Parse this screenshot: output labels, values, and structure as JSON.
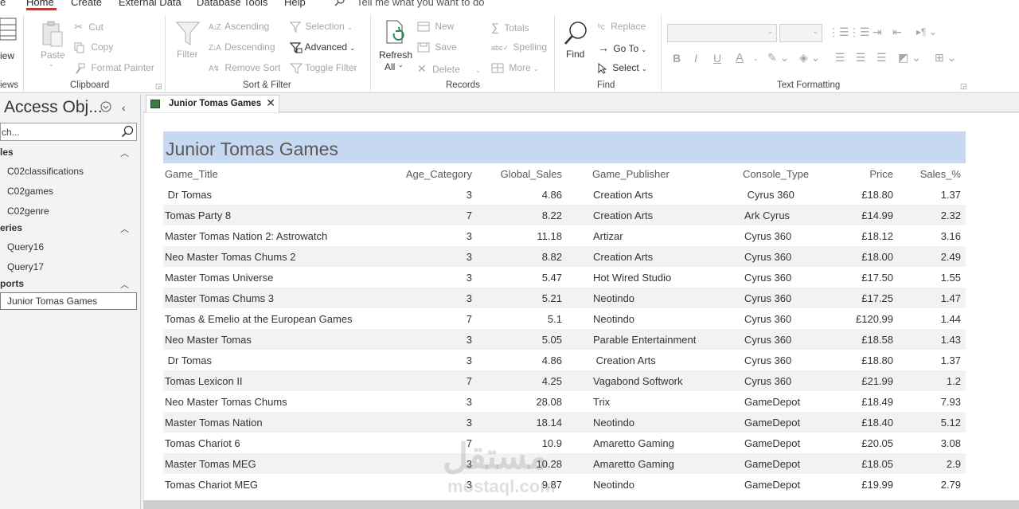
{
  "menu": {
    "tabs": [
      "e",
      "Home",
      "Create",
      "External Data",
      "Database Tools",
      "Help"
    ],
    "tell_me": "Tell me what you want to do"
  },
  "ribbon": {
    "views": {
      "view_label": "iew",
      "group_label": "iews"
    },
    "clipboard": {
      "paste": "Paste",
      "cut": "Cut",
      "copy": "Copy",
      "format_painter": "Format Painter",
      "group_label": "Clipboard"
    },
    "sort_filter": {
      "filter": "Filter",
      "ascending": "Ascending",
      "descending": "Descending",
      "remove_sort": "Remove Sort",
      "selection": "Selection",
      "advanced": "Advanced",
      "toggle_filter": "Toggle Filter",
      "group_label": "Sort & Filter"
    },
    "records": {
      "refresh": "Refresh",
      "refresh_all": "All",
      "new": "New",
      "save": "Save",
      "delete": "Delete",
      "totals": "Totals",
      "spelling": "Spelling",
      "more": "More",
      "group_label": "Records"
    },
    "find": {
      "find": "Find",
      "replace": "Replace",
      "go_to": "Go To",
      "select": "Select",
      "group_label": "Find"
    },
    "text_formatting": {
      "bold": "B",
      "italic": "I",
      "underline": "U",
      "font_color": "A",
      "group_label": "Text Formatting"
    }
  },
  "nav": {
    "title": "Access Obj...",
    "search_placeholder": "ch...",
    "sections": [
      {
        "label": "les",
        "items": [
          "C02classifications",
          "C02games",
          "C02genre"
        ]
      },
      {
        "label": "eries",
        "items": [
          "Query16",
          "Query17"
        ]
      },
      {
        "label": "ports",
        "items": [
          "Junior Tomas Games"
        ]
      }
    ]
  },
  "document": {
    "tab_label": "Junior Tomas Games",
    "report": {
      "title": "Junior Tomas Games",
      "columns": [
        "Game_Title",
        "Age_Category",
        "Global_Sales",
        "Game_Publisher",
        "Console_Type",
        "Price",
        "Sales_%"
      ],
      "rows": [
        [
          " Dr Tomas",
          "3",
          "4.86",
          "Creation Arts",
          " Cyrus 360",
          "£18.80",
          "1.37"
        ],
        [
          "Tomas Party 8",
          "7",
          "8.22",
          "Creation Arts",
          "Ark Cyrus",
          "£14.99",
          "2.32"
        ],
        [
          "Master Tomas Nation 2: Astrowatch",
          "3",
          "11.18",
          "Artizar",
          "Cyrus 360",
          "£18.12",
          "3.16"
        ],
        [
          "Neo Master Tomas Chums 2",
          "3",
          "8.82",
          "Creation Arts",
          "Cyrus 360",
          "£18.00",
          "2.49"
        ],
        [
          "Master Tomas Universe",
          "3",
          "5.47",
          "Hot Wired Studio",
          "Cyrus 360",
          "£17.50",
          "1.55"
        ],
        [
          "Master Tomas Chums 3",
          "3",
          "5.21",
          "Neotindo",
          "Cyrus 360",
          "£17.25",
          "1.47"
        ],
        [
          "Tomas & Emelio at the European Games",
          "7",
          "5.1",
          "Neotindo",
          "Cyrus 360",
          "£120.99",
          "1.44"
        ],
        [
          "Neo Master Tomas",
          "3",
          "5.05",
          "Parable Entertainment",
          "Cyrus 360",
          "£18.58",
          "1.43"
        ],
        [
          " Dr Tomas",
          "3",
          "4.86",
          " Creation Arts",
          "Cyrus 360",
          "£18.80",
          "1.37"
        ],
        [
          "Tomas Lexicon II",
          "7",
          "4.25",
          "Vagabond Softwork",
          "Cyrus 360",
          "£21.99",
          "1.2"
        ],
        [
          "Neo Master Tomas Chums",
          "3",
          "28.08",
          "Trix",
          "GameDepot",
          "£18.49",
          "7.93"
        ],
        [
          "Master Tomas Nation",
          "3",
          "18.14",
          "Neotindo",
          "GameDepot",
          "£18.40",
          "5.12"
        ],
        [
          "Tomas Chariot 6",
          "7",
          "10.9",
          "Amaretto Gaming",
          "GameDepot",
          "£20.05",
          "3.08"
        ],
        [
          "Master Tomas MEG",
          "3",
          "10.28",
          "Amaretto Gaming",
          "GameDepot",
          "£18.05",
          "2.9"
        ],
        [
          "Tomas Chariot MEG",
          "3",
          "9.87",
          "Neotindo",
          "GameDepot",
          "£19.99",
          "2.79"
        ]
      ]
    }
  },
  "watermark": {
    "arabic": "مستقل",
    "latin": "mostaql.com"
  },
  "colors": {
    "accent": "#b83b3b",
    "title_band": "#c6d9f1",
    "row_alt": "#f2f2f2"
  }
}
